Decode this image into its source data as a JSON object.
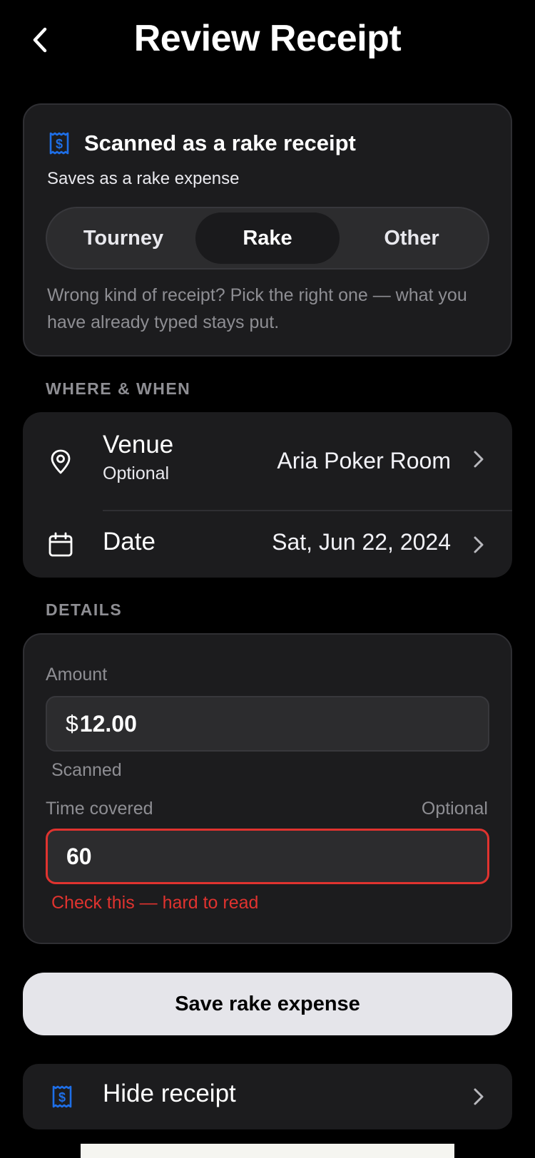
{
  "header": {
    "title": "Review Receipt"
  },
  "scan_card": {
    "title": "Scanned as a rake receipt",
    "subtitle": "Saves as a rake expense",
    "segments": [
      {
        "label": "Tourney",
        "selected": false
      },
      {
        "label": "Rake",
        "selected": true
      },
      {
        "label": "Other",
        "selected": false
      }
    ],
    "help": "Wrong kind of receipt? Pick the right one — what you have already typed stays put."
  },
  "where_when": {
    "section_label": "WHERE & WHEN",
    "venue": {
      "label": "Venue",
      "sublabel": "Optional",
      "value": "Aria Poker Room"
    },
    "date": {
      "label": "Date",
      "value": "Sat, Jun 22, 2024"
    }
  },
  "details": {
    "section_label": "DETAILS",
    "amount": {
      "label": "Amount",
      "prefix": "$",
      "value": "12.00",
      "hint": "Scanned"
    },
    "time_covered": {
      "label": "Time covered",
      "optional_label": "Optional",
      "value": "60",
      "error": "Check this — hard to read"
    }
  },
  "actions": {
    "save_label": "Save rake expense",
    "hide_receipt_label": "Hide receipt"
  },
  "colors": {
    "accent_blue": "#1e6fe8",
    "error_red": "#e0332f",
    "background": "#000000",
    "card": "#1c1c1e"
  },
  "icons": [
    "chevron-left-icon",
    "receipt-dollar-icon",
    "map-pin-icon",
    "calendar-icon",
    "chevron-right-icon"
  ]
}
